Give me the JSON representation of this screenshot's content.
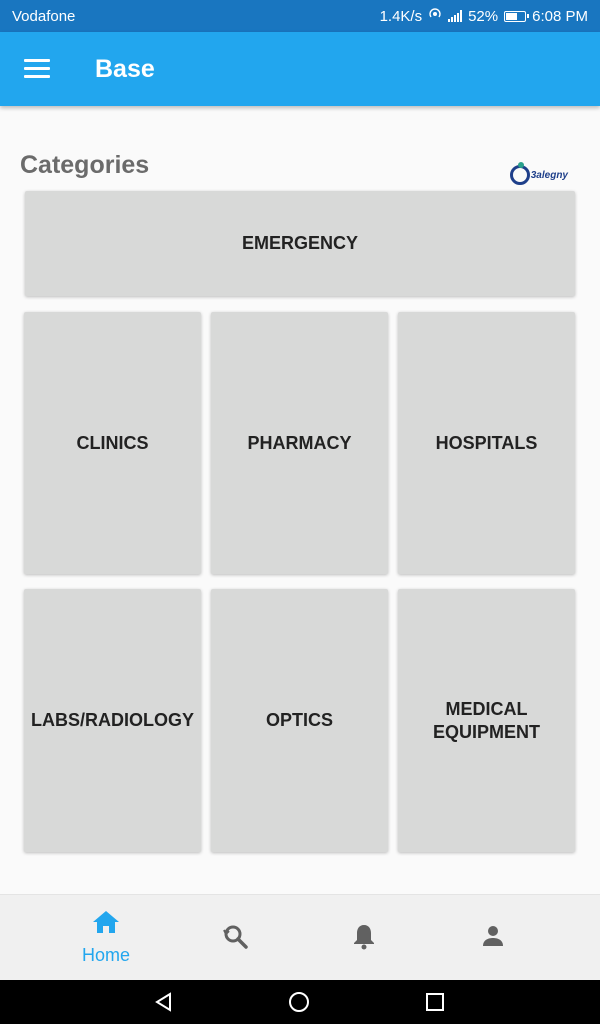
{
  "status_bar": {
    "carrier": "Vodafone",
    "speed": "1.4K/s",
    "battery": "52%",
    "time": "6:08 PM"
  },
  "app_bar": {
    "title": "Base",
    "menu_icon": "hamburger-menu-icon"
  },
  "section": {
    "title": "Categories",
    "logo_text": "3alegny"
  },
  "categories": {
    "emergency": "EMERGENCY",
    "clinics": "CLINICS",
    "pharmacy": "PHARMACY",
    "hospitals": "HOSPITALS",
    "labs": "LABS/RADIOLOGY",
    "optics": "OPTICS",
    "medical_equipment": "MEDICAL\nEQUIPMENT"
  },
  "bottom_nav": {
    "home_label": "Home",
    "icons": [
      "home-icon",
      "search-refresh-icon",
      "bell-icon",
      "person-icon"
    ],
    "active_color": "#22a6ee",
    "inactive_color": "#616161"
  },
  "colors": {
    "status_bar": "#1976c0",
    "app_bar": "#22a6ee",
    "tile": "#d8d9d8"
  }
}
